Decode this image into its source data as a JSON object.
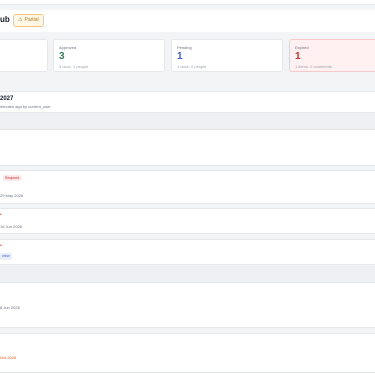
{
  "header": {
    "title_fragment": "ub",
    "status_badge": "Partial"
  },
  "stats": [
    {
      "label": "",
      "value": "",
      "sub": ""
    },
    {
      "label": "Approved",
      "value": "3",
      "sub": "3 docs, 1 people",
      "color": "#2f855a"
    },
    {
      "label": "Pending",
      "value": "1",
      "sub": "1 docs, 0 people",
      "color": "#3b5bdb"
    },
    {
      "label": "Expired",
      "value": "1",
      "sub": "1 items, 0 comments",
      "color": "#c53030"
    }
  ],
  "section": {
    "title": "2027",
    "meta": "minutes ago  by current_user"
  },
  "items": [
    {
      "badge": "Required",
      "date": "29 May 2026"
    },
    {
      "marker": "•",
      "date": "16 Jun 2026"
    },
    {
      "marker": "•",
      "tag": "view"
    },
    {
      "date": "8 Jun 2026"
    },
    {
      "date": "Oct 2026"
    }
  ],
  "colors": {
    "accent_orange": "#ea580c",
    "expired_bg": "#fff1f1"
  }
}
